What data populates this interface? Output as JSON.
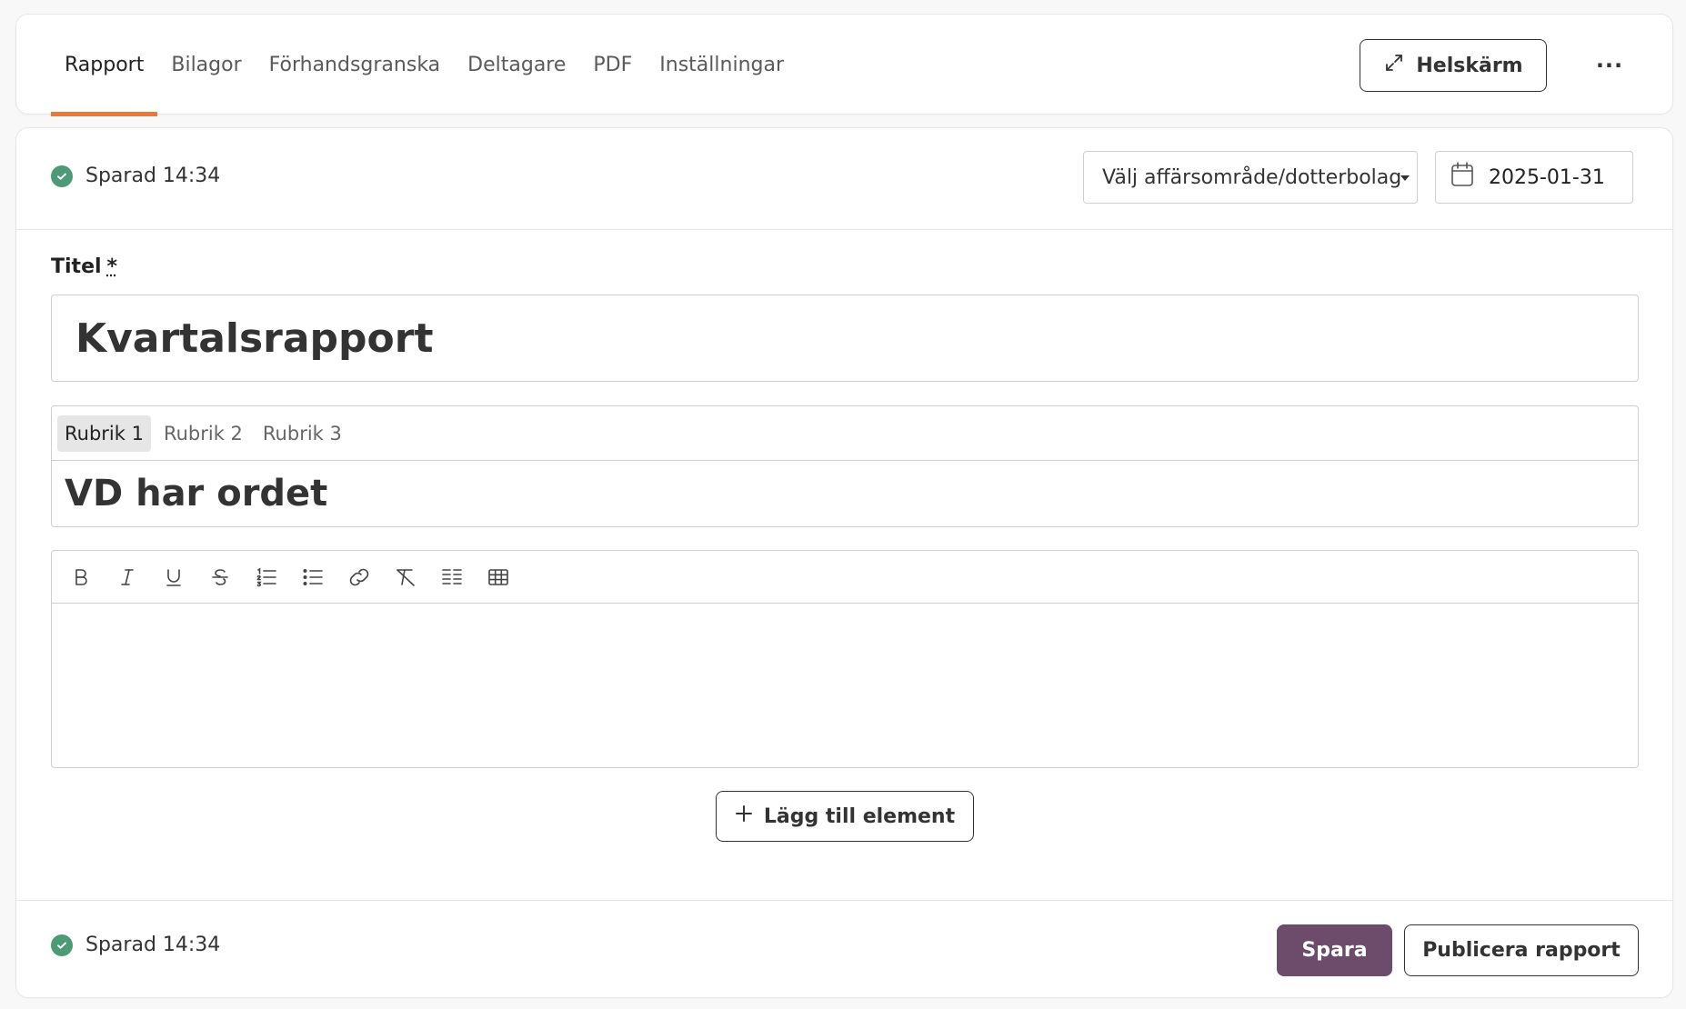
{
  "tabs": [
    {
      "label": "Rapport",
      "active": true
    },
    {
      "label": "Bilagor",
      "active": false
    },
    {
      "label": "Förhandsgranska",
      "active": false
    },
    {
      "label": "Deltagare",
      "active": false
    },
    {
      "label": "PDF",
      "active": false
    },
    {
      "label": "Inställningar",
      "active": false
    }
  ],
  "header": {
    "fullscreen_label": "Helskärm",
    "more_label": "···"
  },
  "status": {
    "saved_text": "Sparad 14:34"
  },
  "filters": {
    "business_area_placeholder": "Välj affärsområde/dotterbolag",
    "date_value": "2025-01-31"
  },
  "form": {
    "title_label": "Titel",
    "required_marker": "*",
    "title_value": "Kvartalsrapport"
  },
  "heading_block": {
    "options": [
      "Rubrik 1",
      "Rubrik 2",
      "Rubrik 3"
    ],
    "selected": "Rubrik 1",
    "text": "VD har ordet"
  },
  "editor": {
    "toolbar": [
      "bold-icon",
      "italic-icon",
      "underline-icon",
      "strikethrough-icon",
      "ordered-list-icon",
      "bullet-list-icon",
      "link-icon",
      "clear-format-icon",
      "columns-icon",
      "table-icon"
    ],
    "content": ""
  },
  "actions": {
    "add_element_label": "Lägg till element",
    "save_label": "Spara",
    "publish_label": "Publicera rapport"
  },
  "colors": {
    "accent_tab": "#e8783a",
    "primary_button": "#6d4b6b",
    "saved_check": "#4d9a76"
  }
}
